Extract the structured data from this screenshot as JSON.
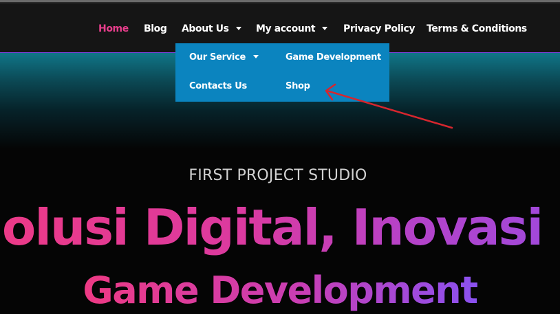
{
  "nav": {
    "items": [
      {
        "label": "Home",
        "active": true
      },
      {
        "label": "Blog"
      },
      {
        "label": "About Us",
        "has_submenu": true
      },
      {
        "label": "My account",
        "has_submenu": true
      },
      {
        "label": "Privacy Policy"
      },
      {
        "label": "Terms & Conditions"
      }
    ]
  },
  "dropdown": {
    "items": [
      {
        "label": "Our Service",
        "has_submenu": true
      },
      {
        "label": "Game Development"
      },
      {
        "label": "Contacts Us"
      },
      {
        "label": "Shop"
      }
    ]
  },
  "annotation": {
    "arrow_color": "#d7262e"
  },
  "hero": {
    "studio_label": "FIRST PROJECT STUDIO",
    "headline": "Solusi Digital, Inovasi Lokal",
    "subheadline": "Game Development"
  },
  "colors": {
    "nav_active": "#e83e8c",
    "dropdown_bg": "#0b84bf",
    "navbar_bg": "#151515",
    "gradient_start": "#ee3a84",
    "gradient_end": "#8a51f0"
  }
}
